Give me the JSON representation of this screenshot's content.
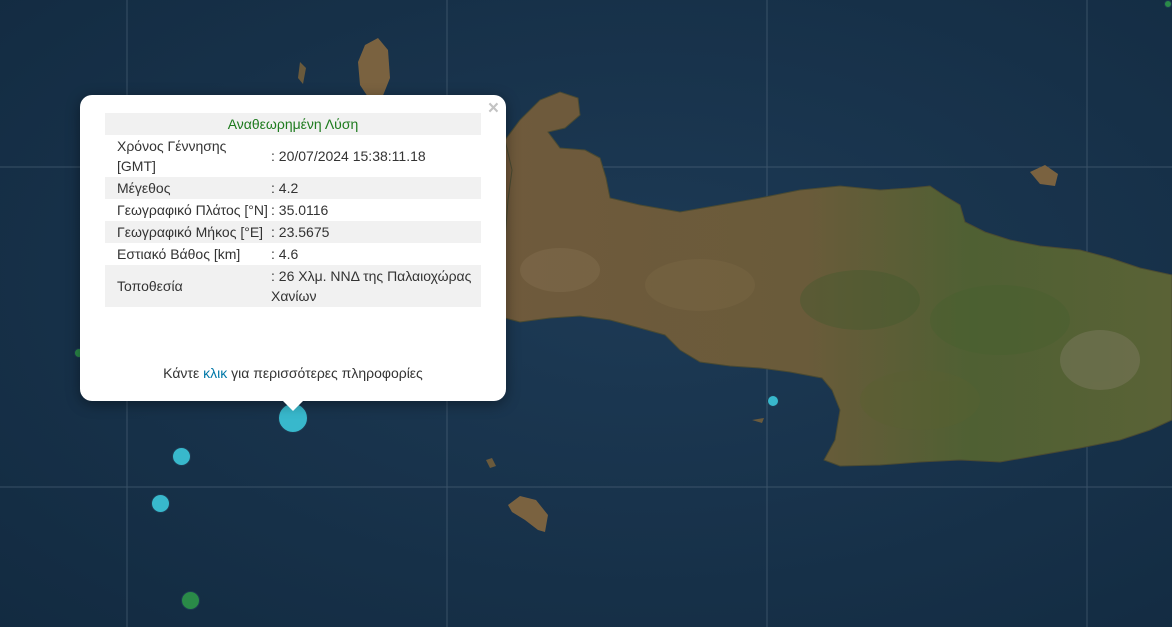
{
  "popup": {
    "header": "Αναθεωρημένη Λύση",
    "rows": [
      {
        "label": "Χρόνος Γέννησης [GMT]",
        "value": ": 20/07/2024 15:38:11.18"
      },
      {
        "label": "Μέγεθος",
        "value": ": 4.2"
      },
      {
        "label": "Γεωγραφικό Πλάτος [°N]",
        "value": ": 35.0116"
      },
      {
        "label": "Γεωγραφικό Μήκος [°E]",
        "value": ": 23.5675"
      },
      {
        "label": "Εστιακό Βάθος [km]",
        "value": ": 4.6"
      },
      {
        "label": "Τοποθεσία",
        "value": ": 26 Χλμ. ΝΝΔ της Παλαιοχώρας Χανίων"
      }
    ],
    "footer_prefix": "Κάντε",
    "footer_link": "κλικ",
    "footer_suffix": "για περισσότερες πληροφορίες",
    "close_symbol": "×"
  },
  "colors": {
    "sea": "#17304a",
    "land": "#6f5b3e",
    "land_green": "#4e5f32",
    "marker_cyan": "#38b8cc",
    "marker_green": "#2a8a48",
    "header_green": "#1e7b1e",
    "link": "#0078a8"
  },
  "markers": [
    {
      "type": "cyan",
      "magnitude": 4.2,
      "selected": true
    },
    {
      "type": "cyan"
    },
    {
      "type": "cyan"
    },
    {
      "type": "cyan"
    },
    {
      "type": "green"
    },
    {
      "type": "green"
    },
    {
      "type": "green"
    }
  ]
}
